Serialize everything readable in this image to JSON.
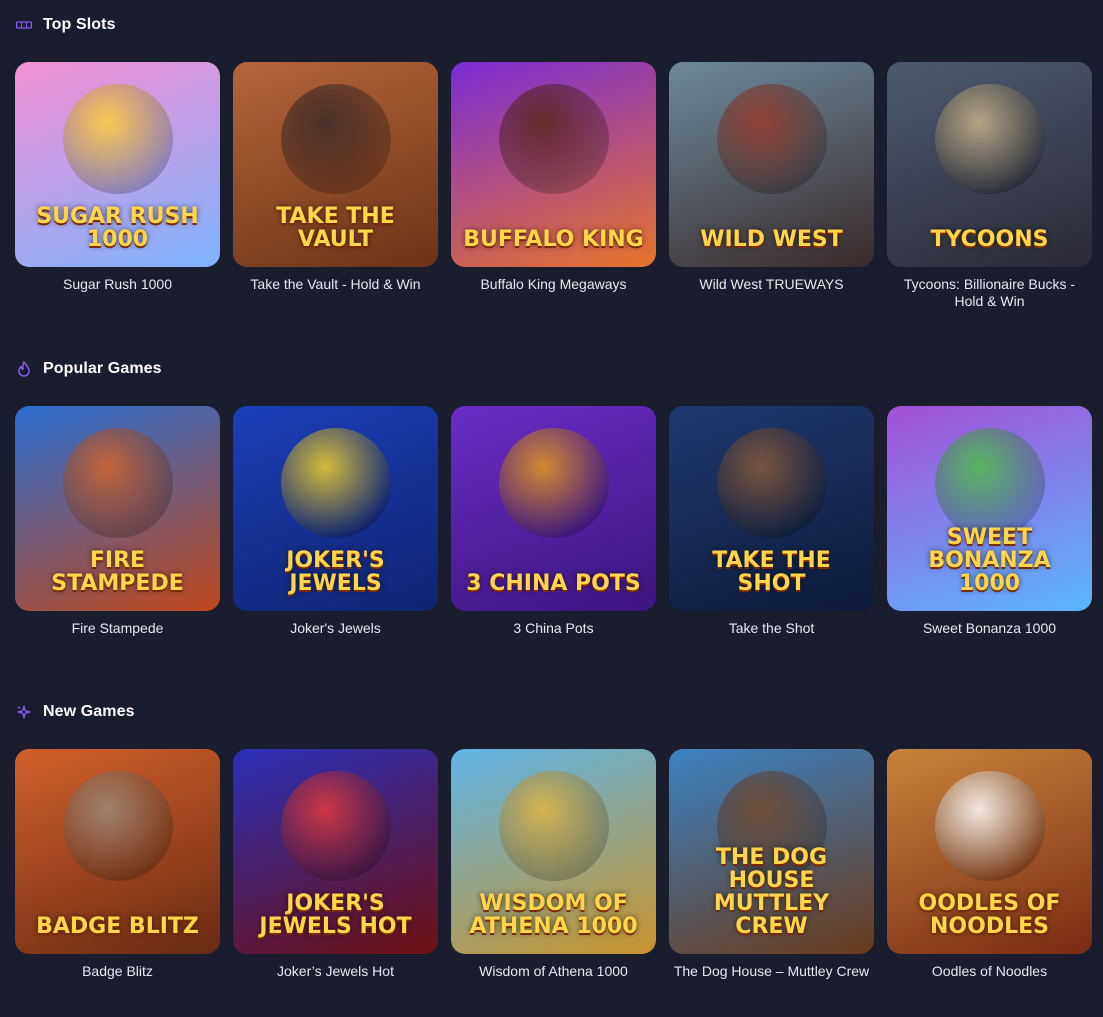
{
  "sections": [
    {
      "title": "Top Slots",
      "icon": "slots-icon",
      "games": [
        {
          "name": "Sugar Rush 1000",
          "logo": "Sugar Rush 1000",
          "bg": [
            "#f48fd4",
            "#7fb4ff"
          ],
          "art": "#ffd23a"
        },
        {
          "name": "Take the Vault - Hold & Win",
          "logo": "Take the Vault",
          "bg": [
            "#b5653a",
            "#6e3218"
          ],
          "art": "#3b2a2a"
        },
        {
          "name": "Buffalo King Megaways",
          "logo": "Buffalo King",
          "bg": [
            "#7b2bd6",
            "#e8742a"
          ],
          "art": "#5a2a1a"
        },
        {
          "name": "Wild West TRUEWAYS",
          "logo": "Wild West",
          "bg": [
            "#6d8a9c",
            "#3a2a2a"
          ],
          "art": "#9c3a2a"
        },
        {
          "name": "Tycoons: Billionaire Bucks - Hold & Win",
          "logo": "Tycoons",
          "bg": [
            "#4e5a70",
            "#2a2a35"
          ],
          "art": "#c9b48a"
        }
      ]
    },
    {
      "title": "Popular Games",
      "icon": "flame-icon",
      "games": [
        {
          "name": "Fire Stampede",
          "logo": "Fire Stampede",
          "bg": [
            "#2a6dd1",
            "#c1481c"
          ],
          "art": "#d8652a"
        },
        {
          "name": "Joker's Jewels",
          "logo": "Joker's Jewels",
          "bg": [
            "#1c3fb8",
            "#0f2370"
          ],
          "art": "#f5d22a"
        },
        {
          "name": "3 China Pots",
          "logo": "3 China Pots",
          "bg": [
            "#6a2cc4",
            "#3d1580"
          ],
          "art": "#e89a1a"
        },
        {
          "name": "Take the Shot",
          "logo": "Take the Shot",
          "bg": [
            "#1f3a6e",
            "#0e1a3a"
          ],
          "art": "#8a5a3a"
        },
        {
          "name": "Sweet Bonanza 1000",
          "logo": "Sweet Bonanza 1000",
          "bg": [
            "#a44fd9",
            "#5bb7ff"
          ],
          "art": "#4fc24a"
        }
      ]
    },
    {
      "title": "New Games",
      "icon": "sparkles-icon",
      "games": [
        {
          "name": "Badge Blitz",
          "logo": "Badge Blitz",
          "bg": [
            "#d2602a",
            "#6a2a14"
          ],
          "art": "#9c8a7a"
        },
        {
          "name": "Joker’s Jewels Hot",
          "logo": "Joker's Jewels Hot",
          "bg": [
            "#2a2fb8",
            "#6e1010"
          ],
          "art": "#e63a3a"
        },
        {
          "name": "Wisdom of Athena 1000",
          "logo": "Wisdom of Athena 1000",
          "bg": [
            "#5fb5e8",
            "#c8932a"
          ],
          "art": "#e6b640"
        },
        {
          "name": "The Dog House – Muttley Crew",
          "logo": "The Dog House Muttley Crew",
          "bg": [
            "#3b82c4",
            "#6a3a1a"
          ],
          "art": "#7a4a2a"
        },
        {
          "name": "Oodles of Noodles",
          "logo": "Oodles of Noodles",
          "bg": [
            "#c9833a",
            "#7a2a14"
          ],
          "art": "#ffffff"
        }
      ]
    }
  ],
  "accent": "#8b5cf6"
}
